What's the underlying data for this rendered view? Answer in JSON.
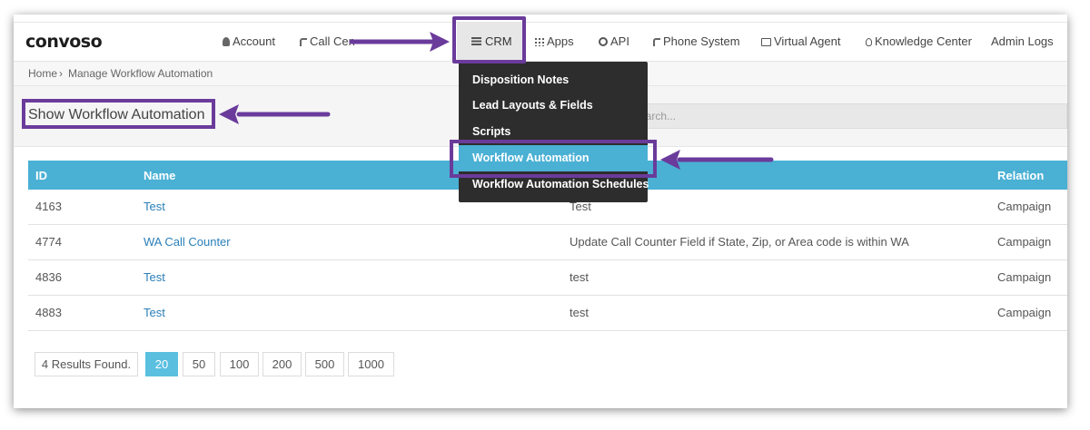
{
  "logo": "convoso",
  "nav": {
    "items": [
      {
        "label": "Account",
        "icon": "user-icon"
      },
      {
        "label": "Call Cen",
        "icon": "phone-icon"
      },
      {
        "label": "CRM",
        "icon": "list-icon"
      },
      {
        "label": "Apps",
        "icon": "grid-icon"
      },
      {
        "label": "API",
        "icon": "gear-icon"
      },
      {
        "label": "Phone System",
        "icon": "phone-icon"
      },
      {
        "label": "Virtual Agent",
        "icon": "monitor-icon"
      },
      {
        "label": "Knowledge Center",
        "icon": "lightbulb-icon"
      },
      {
        "label": "Admin Logs",
        "icon": ""
      }
    ]
  },
  "breadcrumb": {
    "home": "Home",
    "separator": "›",
    "current": "Manage Workflow Automation"
  },
  "page": {
    "title": "Show Workflow Automation",
    "search_placeholder": "earch..."
  },
  "dropdown": {
    "items": [
      {
        "label": "Disposition Notes",
        "active": false
      },
      {
        "label": "Lead Layouts & Fields",
        "active": false
      },
      {
        "label": "Scripts",
        "active": false
      },
      {
        "label": "Workflow Automation",
        "active": true
      },
      {
        "label": "Workflow Automation Schedules",
        "active": false
      }
    ]
  },
  "table": {
    "headers": {
      "id": "ID",
      "name": "Name",
      "relation": "Relation"
    },
    "rows": [
      {
        "id": "4163",
        "name": "Test",
        "description": "Test",
        "relation": "Campaign"
      },
      {
        "id": "4774",
        "name": "WA Call Counter",
        "description": "Update Call Counter Field if State, Zip, or Area code is within WA",
        "relation": "Campaign"
      },
      {
        "id": "4836",
        "name": "Test",
        "description": "test",
        "relation": "Campaign"
      },
      {
        "id": "4883",
        "name": "Test",
        "description": "test",
        "relation": "Campaign"
      }
    ]
  },
  "pagination": {
    "results": "4 Results Found.",
    "sizes": [
      "20",
      "50",
      "100",
      "200",
      "500",
      "1000"
    ],
    "active": "20"
  },
  "colors": {
    "accent": "#4ab0d4",
    "annotation": "#6a3b9b",
    "dropdown_bg": "#2d2d2d",
    "link": "#2a7fb8"
  }
}
